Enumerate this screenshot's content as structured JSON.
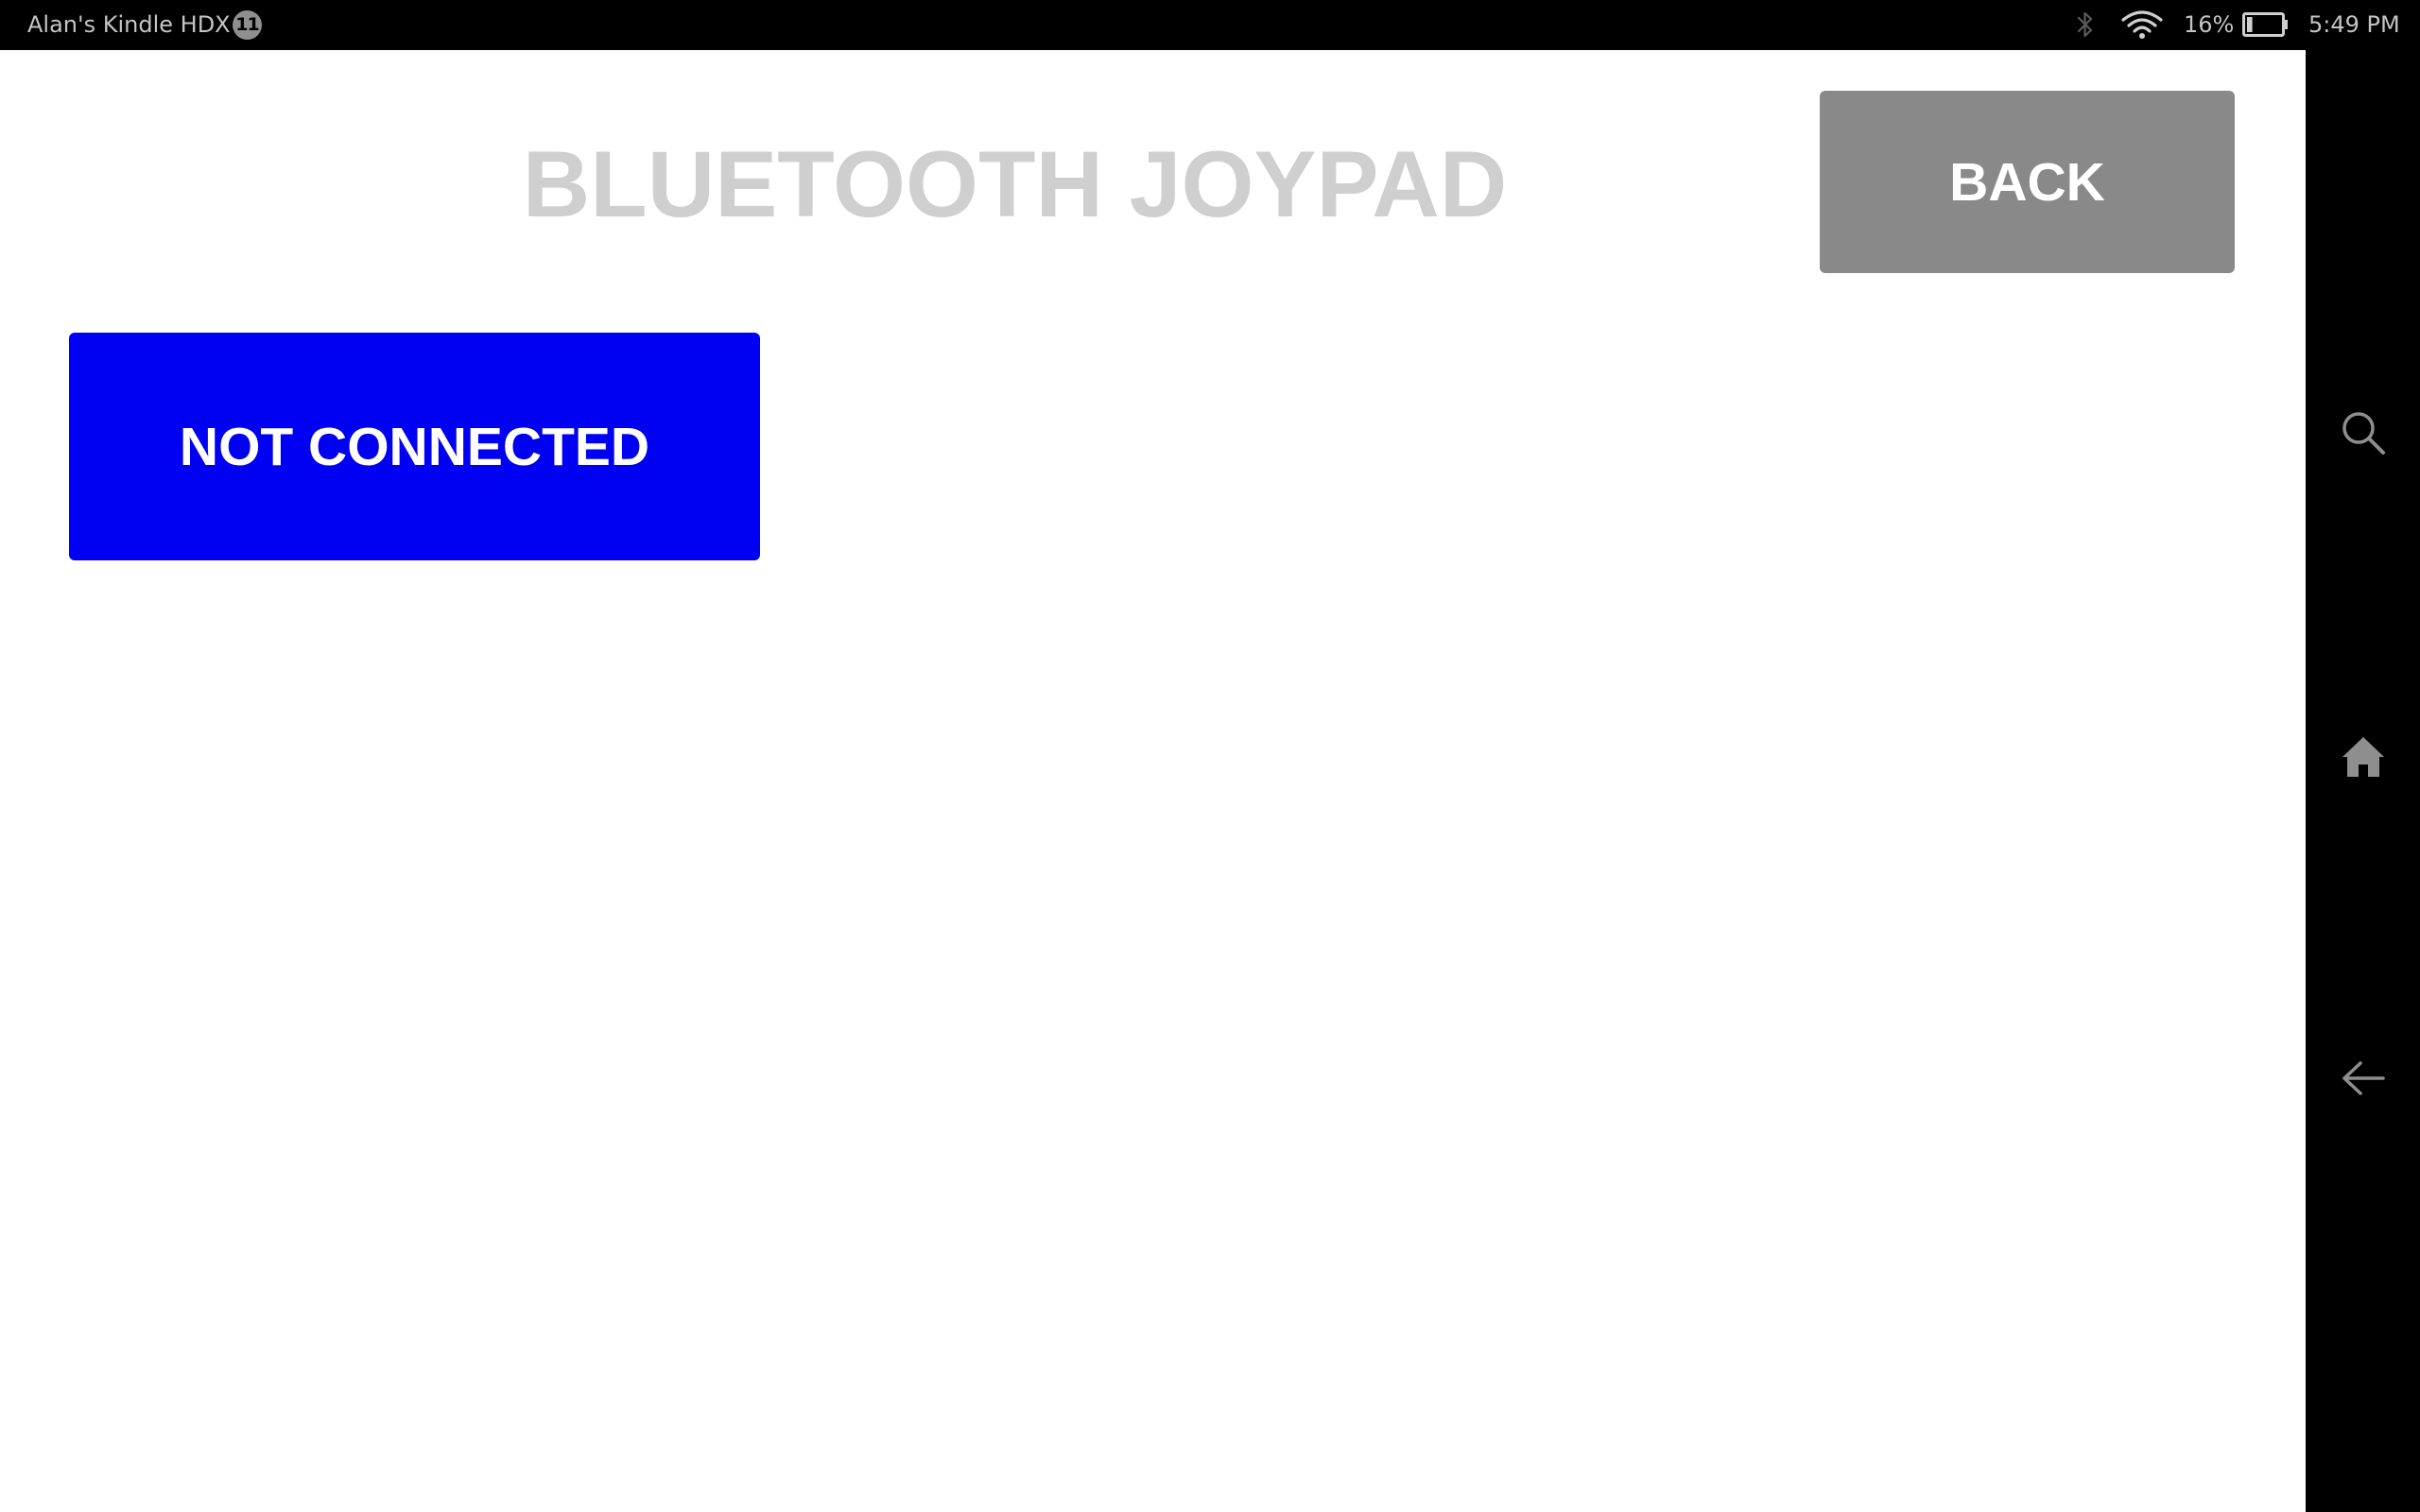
{
  "status_bar": {
    "device_name": "Alan's Kindle HDX",
    "notification_count": "11",
    "battery_percent": "16%",
    "battery_level": 0.16,
    "time": "5:49 PM",
    "icons": [
      "bluetooth-icon",
      "wifi-icon",
      "battery-icon"
    ]
  },
  "app": {
    "title": "BLUETOOTH JOYPAD",
    "back_label": "BACK",
    "connection_status_label": "NOT CONNECTED",
    "colors": {
      "title": "#cfcfcf",
      "back_button": "#898989",
      "connection_button": "#0000f2",
      "button_text": "#ffffff"
    }
  },
  "nav_bar": {
    "items": [
      {
        "icon": "search-icon"
      },
      {
        "icon": "home-icon"
      },
      {
        "icon": "back-arrow-icon"
      }
    ]
  }
}
